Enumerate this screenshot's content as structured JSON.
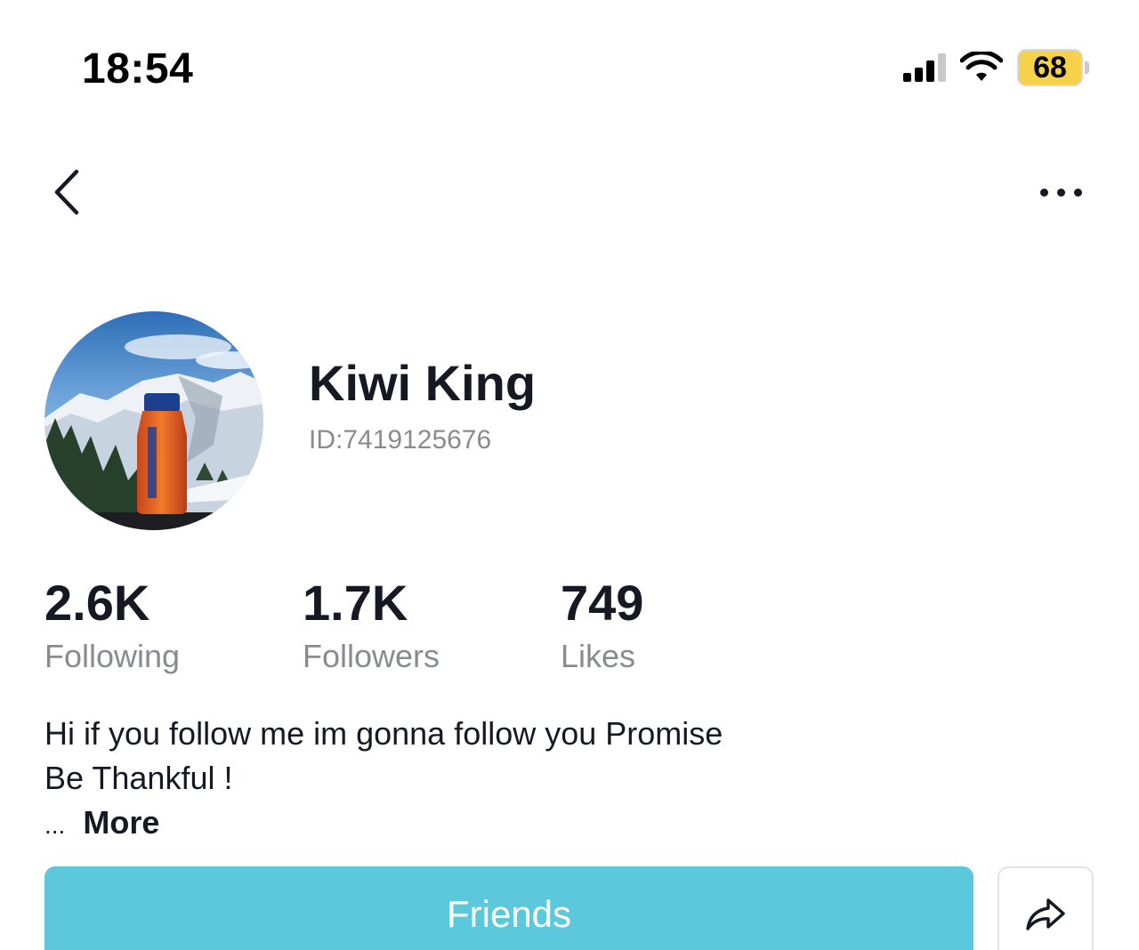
{
  "status_bar": {
    "time": "18:54",
    "battery_level": "68",
    "battery_color": "#f6d24a",
    "icons": [
      "cellular-signal-icon",
      "wifi-icon",
      "battery-icon"
    ]
  },
  "nav": {
    "back_icon": "chevron-left-icon",
    "more_icon": "more-horizontal-icon"
  },
  "profile": {
    "username": "Kiwi King",
    "user_id": "ID:7419125676",
    "avatar": "avatar-photo"
  },
  "stats": [
    {
      "value": "2.6K",
      "label": "Following"
    },
    {
      "value": "1.7K",
      "label": "Followers"
    },
    {
      "value": "749",
      "label": "Likes"
    }
  ],
  "bio": {
    "line1": "Hi if you follow me im gonna follow you Promise",
    "line2": "Be Thankful !",
    "ellipsis": "...",
    "more_label": "More"
  },
  "actions": {
    "friends_label": "Friends",
    "friends_color": "#5bc8db",
    "share_icon": "share-arrow-icon"
  }
}
